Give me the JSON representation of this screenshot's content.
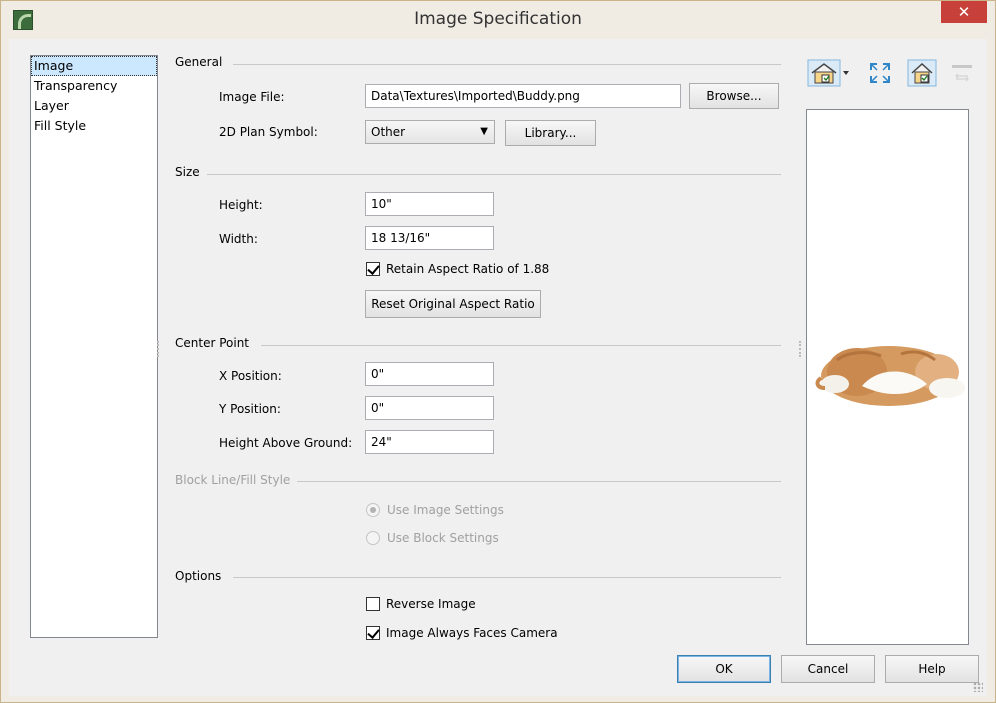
{
  "window": {
    "title": "Image Specification",
    "close_glyph": "✕"
  },
  "nav": {
    "items": [
      "Image",
      "Transparency",
      "Layer",
      "Fill Style"
    ],
    "selected": 0
  },
  "general": {
    "heading": "General",
    "image_file_label": "Image File:",
    "image_file_value": "Data\\Textures\\Imported\\Buddy.png",
    "browse_label": "Browse...",
    "plan_symbol_label": "2D Plan Symbol:",
    "plan_symbol_value": "Other",
    "library_label": "Library..."
  },
  "size": {
    "heading": "Size",
    "height_label": "Height:",
    "height_value": "10\"",
    "width_label": "Width:",
    "width_value": "18 13/16\"",
    "retain_label": "Retain Aspect Ratio of 1.88",
    "retain_checked": true,
    "reset_label": "Reset Original Aspect Ratio"
  },
  "center": {
    "heading": "Center Point",
    "x_label": "X Position:",
    "x_value": "0\"",
    "y_label": "Y Position:",
    "y_value": "0\"",
    "hag_label": "Height Above Ground:",
    "hag_value": "24\""
  },
  "block": {
    "heading": "Block Line/Fill Style",
    "use_image_label": "Use Image Settings",
    "use_block_label": "Use Block Settings",
    "selected": "use_image"
  },
  "options": {
    "heading": "Options",
    "reverse_label": "Reverse Image",
    "reverse_checked": false,
    "faces_label": "Image Always Faces Camera",
    "faces_checked": true
  },
  "footer": {
    "ok": "OK",
    "cancel": "Cancel",
    "help": "Help"
  },
  "preview_toolbar": [
    "view-options-icon",
    "fill-window-icon",
    "preview-mode-icon",
    "sync-icon"
  ],
  "colors": {
    "accent": "#3c7fb1",
    "close": "#c7413a",
    "selection": "#cce8ff"
  }
}
